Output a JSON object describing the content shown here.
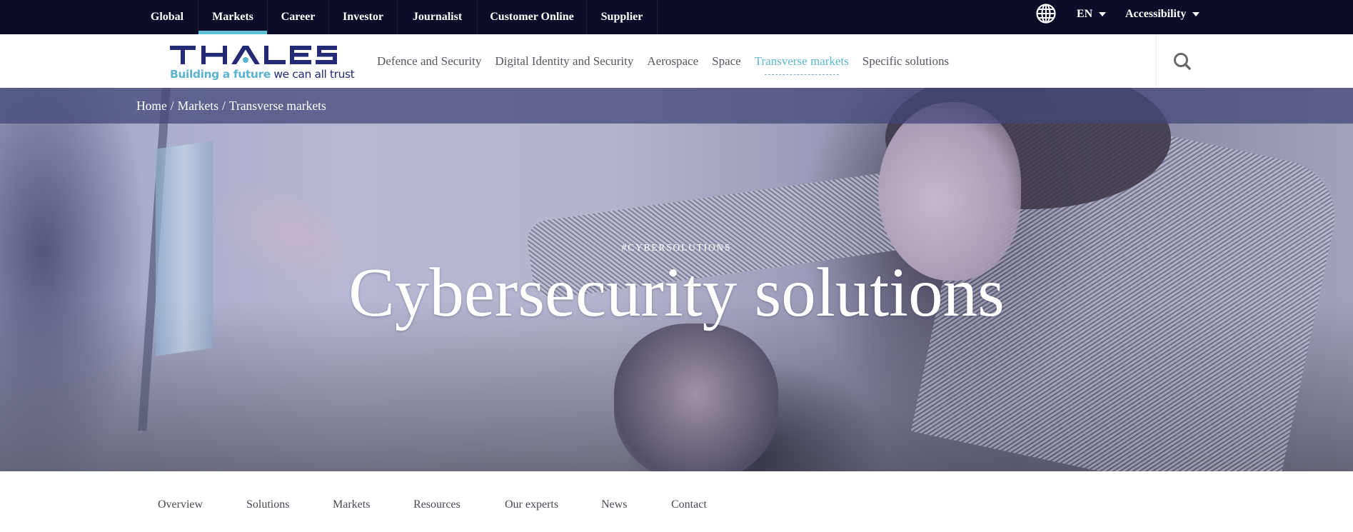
{
  "topbar": {
    "links": [
      {
        "label": "Global",
        "active": false
      },
      {
        "label": "Markets",
        "active": true
      },
      {
        "label": "Career",
        "active": false
      },
      {
        "label": "Investor",
        "active": false
      },
      {
        "label": "Journalist",
        "active": false
      },
      {
        "label": "Customer Online",
        "active": false
      },
      {
        "label": "Supplier",
        "active": false
      }
    ],
    "globe_icon": "globe-icon",
    "language": "EN",
    "accessibility": "Accessibility",
    "accent_color": "#5bbfd6",
    "background_color": "#0c0d28"
  },
  "header": {
    "logo": {
      "wordmark": "THALES",
      "tagline_highlight": "Building a future",
      "tagline_rest": " we can all trust",
      "navy": "#242a75",
      "cyan": "#5bb3d0"
    },
    "nav": [
      {
        "label": "Defence and Security",
        "active": false
      },
      {
        "label": "Digital Identity and Security",
        "active": false
      },
      {
        "label": "Aerospace",
        "active": false
      },
      {
        "label": "Space",
        "active": false
      },
      {
        "label": "Transverse markets",
        "active": true
      },
      {
        "label": "Specific solutions",
        "active": false
      }
    ],
    "search_icon": "search-icon"
  },
  "hero": {
    "breadcrumb": [
      {
        "label": "Home"
      },
      {
        "label": "Markets"
      },
      {
        "label": "Transverse markets"
      }
    ],
    "breadcrumb_separator": "/",
    "tag": "#CYBERSOLUTIONS",
    "title": "Cybersecurity solutions"
  },
  "subnav": {
    "items": [
      {
        "label": "Overview"
      },
      {
        "label": "Solutions"
      },
      {
        "label": "Markets"
      },
      {
        "label": "Resources"
      },
      {
        "label": "Our experts"
      },
      {
        "label": "News"
      },
      {
        "label": "Contact"
      }
    ]
  }
}
